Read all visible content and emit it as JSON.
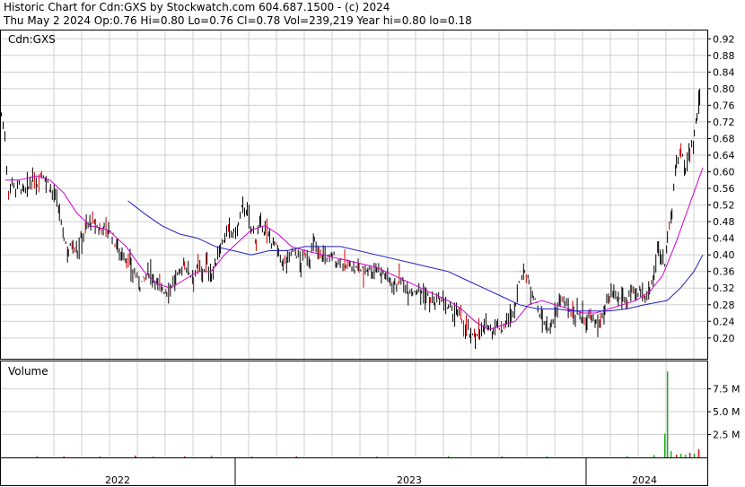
{
  "header": {
    "line1": "Historic Chart for Cdn:GXS by Stockwatch.com 604.687.1500 - (c) 2024",
    "line2": "Thu May  2 2024  Op:0.76  Hi=0.80  Lo=0.76  Cl=0.78  Vol=239,219  Year hi=0.80  lo=0.18"
  },
  "price_panel": {
    "symbol_label": "Cdn:GXS"
  },
  "volume_panel": {
    "label": "Volume"
  },
  "colors": {
    "ma_short": "#d000d0",
    "ma_long": "#2020c0",
    "up": "#000000",
    "down": "#cc0000",
    "vol_up": "#22aa22",
    "vol_down": "#d01010"
  },
  "chart_data": [
    {
      "type": "line",
      "title": "Historic Chart for Cdn:GXS",
      "ylabel": "",
      "ylim": [
        0.15,
        0.94
      ],
      "y_ticks": [
        "0.92",
        "0.88",
        "0.84",
        "0.80",
        "0.76",
        "0.72",
        "0.68",
        "0.64",
        "0.60",
        "0.56",
        "0.52",
        "0.48",
        "0.44",
        "0.40",
        "0.36",
        "0.32",
        "0.28",
        "0.24",
        "0.20"
      ],
      "x_ticks": [
        "2022",
        "2023",
        "2024"
      ],
      "series": [
        {
          "kind": "price_close",
          "points": [
            [
              0,
              0.74
            ],
            [
              4,
              0.68
            ],
            [
              8,
              0.55
            ],
            [
              12,
              0.58
            ],
            [
              16,
              0.56
            ],
            [
              20,
              0.57
            ],
            [
              25,
              0.55
            ],
            [
              30,
              0.56
            ],
            [
              35,
              0.58
            ],
            [
              40,
              0.57
            ],
            [
              45,
              0.6
            ],
            [
              50,
              0.58
            ],
            [
              55,
              0.56
            ],
            [
              60,
              0.54
            ],
            [
              65,
              0.5
            ],
            [
              70,
              0.44
            ],
            [
              75,
              0.41
            ],
            [
              80,
              0.43
            ],
            [
              85,
              0.41
            ],
            [
              90,
              0.44
            ],
            [
              95,
              0.47
            ],
            [
              100,
              0.48
            ],
            [
              105,
              0.47
            ],
            [
              110,
              0.46
            ],
            [
              115,
              0.47
            ],
            [
              120,
              0.46
            ],
            [
              125,
              0.44
            ],
            [
              130,
              0.42
            ],
            [
              135,
              0.4
            ],
            [
              140,
              0.39
            ],
            [
              145,
              0.37
            ],
            [
              150,
              0.35
            ],
            [
              155,
              0.33
            ],
            [
              160,
              0.34
            ],
            [
              165,
              0.36
            ],
            [
              170,
              0.35
            ],
            [
              175,
              0.33
            ],
            [
              180,
              0.32
            ],
            [
              185,
              0.31
            ],
            [
              190,
              0.33
            ],
            [
              195,
              0.34
            ],
            [
              200,
              0.36
            ],
            [
              205,
              0.38
            ],
            [
              210,
              0.36
            ],
            [
              215,
              0.35
            ],
            [
              220,
              0.37
            ],
            [
              225,
              0.36
            ],
            [
              230,
              0.38
            ],
            [
              235,
              0.35
            ],
            [
              240,
              0.38
            ],
            [
              245,
              0.42
            ],
            [
              250,
              0.44
            ],
            [
              255,
              0.46
            ],
            [
              260,
              0.45
            ],
            [
              265,
              0.47
            ],
            [
              270,
              0.52
            ],
            [
              275,
              0.5
            ],
            [
              280,
              0.46
            ],
            [
              285,
              0.44
            ],
            [
              290,
              0.47
            ],
            [
              295,
              0.46
            ],
            [
              300,
              0.44
            ],
            [
              305,
              0.43
            ],
            [
              310,
              0.4
            ],
            [
              315,
              0.38
            ],
            [
              320,
              0.39
            ],
            [
              325,
              0.41
            ],
            [
              330,
              0.4
            ],
            [
              335,
              0.38
            ],
            [
              340,
              0.4
            ],
            [
              345,
              0.39
            ],
            [
              350,
              0.43
            ],
            [
              355,
              0.41
            ],
            [
              360,
              0.4
            ],
            [
              365,
              0.39
            ],
            [
              370,
              0.4
            ],
            [
              375,
              0.38
            ],
            [
              380,
              0.39
            ],
            [
              385,
              0.37
            ],
            [
              390,
              0.38
            ],
            [
              395,
              0.36
            ],
            [
              400,
              0.37
            ],
            [
              405,
              0.36
            ],
            [
              410,
              0.37
            ],
            [
              415,
              0.36
            ],
            [
              420,
              0.37
            ],
            [
              425,
              0.36
            ],
            [
              430,
              0.35
            ],
            [
              435,
              0.34
            ],
            [
              440,
              0.33
            ],
            [
              445,
              0.34
            ],
            [
              450,
              0.33
            ],
            [
              455,
              0.32
            ],
            [
              460,
              0.31
            ],
            [
              465,
              0.32
            ],
            [
              470,
              0.31
            ],
            [
              475,
              0.3
            ],
            [
              480,
              0.29
            ],
            [
              485,
              0.28
            ],
            [
              490,
              0.29
            ],
            [
              495,
              0.28
            ],
            [
              500,
              0.27
            ],
            [
              505,
              0.26
            ],
            [
              510,
              0.26
            ],
            [
              515,
              0.24
            ],
            [
              520,
              0.23
            ],
            [
              525,
              0.2
            ],
            [
              530,
              0.21
            ],
            [
              535,
              0.22
            ],
            [
              540,
              0.22
            ],
            [
              545,
              0.23
            ],
            [
              550,
              0.22
            ],
            [
              555,
              0.23
            ],
            [
              560,
              0.22
            ],
            [
              565,
              0.24
            ],
            [
              570,
              0.25
            ],
            [
              575,
              0.28
            ],
            [
              580,
              0.35
            ],
            [
              585,
              0.36
            ],
            [
              590,
              0.33
            ],
            [
              595,
              0.31
            ],
            [
              600,
              0.27
            ],
            [
              605,
              0.24
            ],
            [
              610,
              0.23
            ],
            [
              615,
              0.22
            ],
            [
              620,
              0.26
            ],
            [
              625,
              0.3
            ],
            [
              630,
              0.28
            ],
            [
              635,
              0.27
            ],
            [
              640,
              0.26
            ],
            [
              645,
              0.26
            ],
            [
              650,
              0.25
            ],
            [
              655,
              0.24
            ],
            [
              660,
              0.25
            ],
            [
              665,
              0.23
            ],
            [
              670,
              0.24
            ],
            [
              675,
              0.27
            ],
            [
              680,
              0.29
            ],
            [
              685,
              0.3
            ],
            [
              690,
              0.29
            ],
            [
              695,
              0.3
            ],
            [
              700,
              0.29
            ],
            [
              705,
              0.31
            ],
            [
              710,
              0.3
            ],
            [
              715,
              0.31
            ],
            [
              720,
              0.3
            ],
            [
              725,
              0.32
            ],
            [
              730,
              0.36
            ],
            [
              735,
              0.42
            ],
            [
              738,
              0.39
            ],
            [
              742,
              0.38
            ],
            [
              745,
              0.45
            ],
            [
              750,
              0.5
            ],
            [
              755,
              0.62
            ],
            [
              760,
              0.65
            ],
            [
              765,
              0.6
            ],
            [
              770,
              0.66
            ],
            [
              775,
              0.68
            ],
            [
              778,
              0.74
            ],
            [
              781,
              0.78
            ]
          ]
        },
        {
          "name": "",
          "kind": "moving_average_short",
          "points": [
            [
              5,
              0.58
            ],
            [
              20,
              0.58
            ],
            [
              40,
              0.59
            ],
            [
              55,
              0.58
            ],
            [
              70,
              0.55
            ],
            [
              85,
              0.5
            ],
            [
              100,
              0.47
            ],
            [
              120,
              0.46
            ],
            [
              140,
              0.42
            ],
            [
              160,
              0.36
            ],
            [
              175,
              0.33
            ],
            [
              190,
              0.32
            ],
            [
              205,
              0.34
            ],
            [
              220,
              0.36
            ],
            [
              235,
              0.36
            ],
            [
              250,
              0.4
            ],
            [
              265,
              0.43
            ],
            [
              280,
              0.46
            ],
            [
              295,
              0.47
            ],
            [
              310,
              0.45
            ],
            [
              325,
              0.42
            ],
            [
              340,
              0.41
            ],
            [
              360,
              0.4
            ],
            [
              380,
              0.39
            ],
            [
              400,
              0.38
            ],
            [
              420,
              0.37
            ],
            [
              440,
              0.35
            ],
            [
              460,
              0.33
            ],
            [
              480,
              0.31
            ],
            [
              500,
              0.29
            ],
            [
              515,
              0.27
            ],
            [
              530,
              0.24
            ],
            [
              545,
              0.22
            ],
            [
              560,
              0.23
            ],
            [
              575,
              0.24
            ],
            [
              590,
              0.28
            ],
            [
              605,
              0.29
            ],
            [
              620,
              0.28
            ],
            [
              635,
              0.27
            ],
            [
              650,
              0.26
            ],
            [
              665,
              0.26
            ],
            [
              680,
              0.27
            ],
            [
              695,
              0.28
            ],
            [
              710,
              0.29
            ],
            [
              725,
              0.31
            ],
            [
              740,
              0.35
            ],
            [
              755,
              0.43
            ],
            [
              770,
              0.52
            ],
            [
              785,
              0.61
            ]
          ]
        },
        {
          "name": "",
          "kind": "moving_average_long",
          "points": [
            [
              142,
              0.53
            ],
            [
              160,
              0.5
            ],
            [
              180,
              0.47
            ],
            [
              200,
              0.45
            ],
            [
              220,
              0.44
            ],
            [
              240,
              0.42
            ],
            [
              260,
              0.41
            ],
            [
              280,
              0.4
            ],
            [
              300,
              0.41
            ],
            [
              320,
              0.41
            ],
            [
              340,
              0.42
            ],
            [
              360,
              0.42
            ],
            [
              380,
              0.42
            ],
            [
              400,
              0.41
            ],
            [
              420,
              0.4
            ],
            [
              440,
              0.39
            ],
            [
              460,
              0.38
            ],
            [
              480,
              0.37
            ],
            [
              500,
              0.36
            ],
            [
              520,
              0.34
            ],
            [
              540,
              0.32
            ],
            [
              560,
              0.3
            ],
            [
              580,
              0.28
            ],
            [
              600,
              0.27
            ],
            [
              620,
              0.27
            ],
            [
              640,
              0.265
            ],
            [
              660,
              0.265
            ],
            [
              680,
              0.265
            ],
            [
              700,
              0.27
            ],
            [
              720,
              0.28
            ],
            [
              745,
              0.29
            ],
            [
              760,
              0.32
            ],
            [
              775,
              0.36
            ],
            [
              785,
              0.4
            ]
          ]
        }
      ]
    },
    {
      "type": "bar",
      "title": "Volume",
      "y_ticks": [
        "7.5 M",
        "5.0 M",
        "2.5 M"
      ],
      "ylim": [
        0,
        10.5
      ],
      "series": [
        {
          "kind": "volume",
          "points": [
            [
              40,
              0.15,
              "g"
            ],
            [
              70,
              0.1,
              "r"
            ],
            [
              110,
              0.12,
              "g"
            ],
            [
              150,
              0.2,
              "r"
            ],
            [
              170,
              0.1,
              "g"
            ],
            [
              205,
              0.12,
              "r"
            ],
            [
              235,
              0.18,
              "g"
            ],
            [
              280,
              0.1,
              "g"
            ],
            [
              330,
              0.12,
              "r"
            ],
            [
              420,
              0.1,
              "g"
            ],
            [
              500,
              0.15,
              "g"
            ],
            [
              560,
              0.1,
              "r"
            ],
            [
              610,
              0.12,
              "g"
            ],
            [
              700,
              0.15,
              "g"
            ],
            [
              730,
              0.25,
              "g"
            ],
            [
              742,
              2.6,
              "g"
            ],
            [
              745,
              9.4,
              "g"
            ],
            [
              749,
              0.7,
              "g"
            ],
            [
              755,
              0.3,
              "r"
            ],
            [
              760,
              0.4,
              "g"
            ],
            [
              765,
              0.3,
              "g"
            ],
            [
              770,
              0.5,
              "r"
            ],
            [
              775,
              0.4,
              "g"
            ],
            [
              780,
              0.9,
              "r"
            ]
          ]
        }
      ]
    }
  ]
}
